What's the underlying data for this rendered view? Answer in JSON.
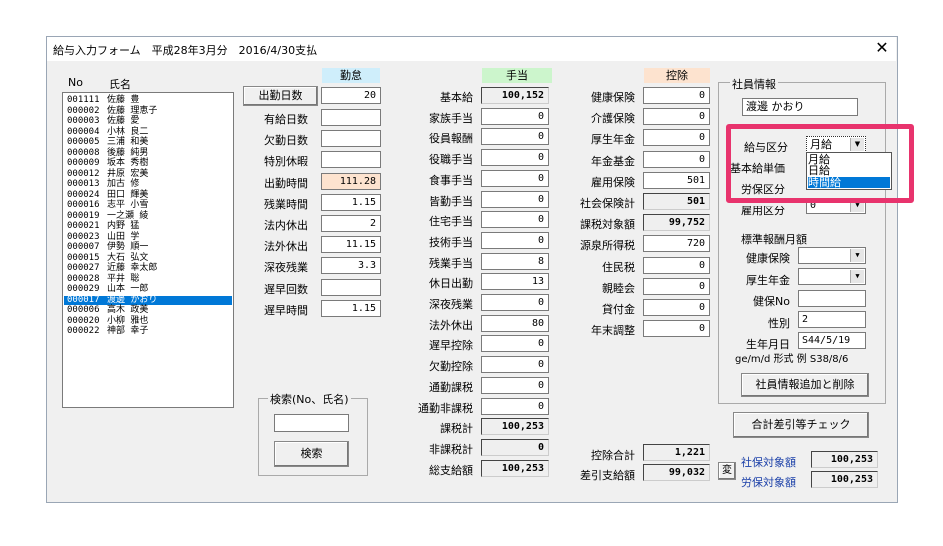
{
  "window": {
    "title": "給与入力フォーム　平成28年3月分　2016/4/30支払",
    "close": "✕"
  },
  "list": {
    "col_no": "No",
    "col_name": "氏名",
    "items": [
      {
        "no": "001111",
        "name": "佐藤 豊"
      },
      {
        "no": "000002",
        "name": "佐藤 理恵子"
      },
      {
        "no": "000003",
        "name": "佐藤 愛"
      },
      {
        "no": "000004",
        "name": "小林 良二"
      },
      {
        "no": "000005",
        "name": "三浦 和美"
      },
      {
        "no": "000008",
        "name": "後藤 純男"
      },
      {
        "no": "000009",
        "name": "坂本 秀樹"
      },
      {
        "no": "000012",
        "name": "井原 宏美"
      },
      {
        "no": "000013",
        "name": "加古 修"
      },
      {
        "no": "000024",
        "name": "田口 輝美"
      },
      {
        "no": "000016",
        "name": "志平 小雪"
      },
      {
        "no": "000019",
        "name": "一之瀬 綾"
      },
      {
        "no": "000021",
        "name": "内野 猛"
      },
      {
        "no": "000023",
        "name": "山田 学"
      },
      {
        "no": "000007",
        "name": "伊勢 順一"
      },
      {
        "no": "000015",
        "name": "大石 弘文"
      },
      {
        "no": "000027",
        "name": "近藤 幸太郎"
      },
      {
        "no": "000028",
        "name": "平井 聡"
      },
      {
        "no": "000029",
        "name": "山本 一郎"
      },
      {
        "no": "000017",
        "name": "渡邊 かおり"
      },
      {
        "no": "000006",
        "name": "高木 政美"
      },
      {
        "no": "000020",
        "name": "小柳 雅也"
      },
      {
        "no": "000022",
        "name": "神部 幸子"
      }
    ],
    "selected_index": 19
  },
  "search": {
    "group_label": "検索(No、氏名)",
    "value": "",
    "button": "検索"
  },
  "kintai": {
    "header": "勤怠",
    "header_color": "#cfeefb",
    "button": "出勤日数",
    "button_value": "20",
    "rows": [
      {
        "label": "有給日数",
        "value": ""
      },
      {
        "label": "欠勤日数",
        "value": ""
      },
      {
        "label": "特別休暇",
        "value": ""
      },
      {
        "label": "出勤時間",
        "value": "111.28"
      },
      {
        "label": "残業時間",
        "value": "1.15"
      },
      {
        "label": "法内休出",
        "value": "2"
      },
      {
        "label": "法外休出",
        "value": "11.15"
      },
      {
        "label": "深夜残業",
        "value": "3.3"
      },
      {
        "label": "遅早回数",
        "value": ""
      },
      {
        "label": "遅早時間",
        "value": "1.15"
      }
    ]
  },
  "teate": {
    "header": "手当",
    "header_color": "#ccf5cc",
    "rows": [
      {
        "label": "基本給",
        "value": "100,152",
        "bold": true
      },
      {
        "label": "家族手当",
        "value": "0"
      },
      {
        "label": "役員報酬",
        "value": "0"
      },
      {
        "label": "役職手当",
        "value": "0"
      },
      {
        "label": "食事手当",
        "value": "0"
      },
      {
        "label": "皆勤手当",
        "value": "0"
      },
      {
        "label": "住宅手当",
        "value": "0"
      },
      {
        "label": "技術手当",
        "value": "0"
      },
      {
        "label": "残業手当",
        "value": "8"
      },
      {
        "label": "休日出勤",
        "value": "13"
      },
      {
        "label": "深夜残業",
        "value": "0"
      },
      {
        "label": "法外休出",
        "value": "80"
      },
      {
        "label": "遅早控除",
        "value": "0"
      },
      {
        "label": "欠勤控除",
        "value": "0"
      },
      {
        "label": "通勤課税",
        "value": "0"
      },
      {
        "label": "通勤非課税",
        "value": "0"
      },
      {
        "label": "課税計",
        "value": "100,253",
        "bold": true
      },
      {
        "label": "非課税計",
        "value": "0",
        "bold": true
      },
      {
        "label": "総支給額",
        "value": "100,253",
        "bold": true
      }
    ]
  },
  "koujo": {
    "header": "控除",
    "header_color": "#fde3cf",
    "rows": [
      {
        "label": "健康保険",
        "value": "0"
      },
      {
        "label": "介護保険",
        "value": "0"
      },
      {
        "label": "厚生年金",
        "value": "0"
      },
      {
        "label": "年金基金",
        "value": "0"
      },
      {
        "label": "雇用保険",
        "value": "501"
      },
      {
        "label": "社会保険計",
        "value": "501",
        "bold": true
      },
      {
        "label": "課税対象額",
        "value": "99,752",
        "bold": true
      },
      {
        "label": "源泉所得税",
        "value": "720"
      },
      {
        "label": "住民税",
        "value": "0"
      },
      {
        "label": "親睦会",
        "value": "0"
      },
      {
        "label": "貸付金",
        "value": "0"
      },
      {
        "label": "年末調整",
        "value": "0"
      }
    ],
    "total_label": "控除合計",
    "total_value": "1,221",
    "net_label": "差引支給額",
    "net_value": "99,032",
    "change_button": "変"
  },
  "shain": {
    "group_label": "社員情報",
    "name": "渡邊 かおり",
    "kyuyo_kubun_label": "給与区分",
    "kyuyo_kubun_value": "月給",
    "dropdown_options": [
      "月給",
      "日給",
      "時間給"
    ],
    "dropdown_highlight": 2,
    "kihonkyu_label": "基本給単価",
    "rouho_label": "労保区分",
    "koyo_label": "雇用区分",
    "koyo_value": "0",
    "hyojun_label": "標準報酬月額",
    "kenko_label": "健康保険",
    "kosei_label": "厚生年金",
    "kenpo_no_label": "健保No",
    "seibetsu_label": "性別",
    "seibetsu_value": "2",
    "birth_label": "生年月日",
    "birth_value": "S44/5/19",
    "format_hint": "ge/m/d 形式 例 S38/8/6",
    "add_delete_button": "社員情報追加と削除",
    "highlight_color": "#e8336d"
  },
  "check_button": "合計差引等チェック",
  "taisho": {
    "shaho_label": "社保対象額",
    "shaho_value": "100,253",
    "rouho_label": "労保対象額",
    "rouho_value": "100,253"
  }
}
